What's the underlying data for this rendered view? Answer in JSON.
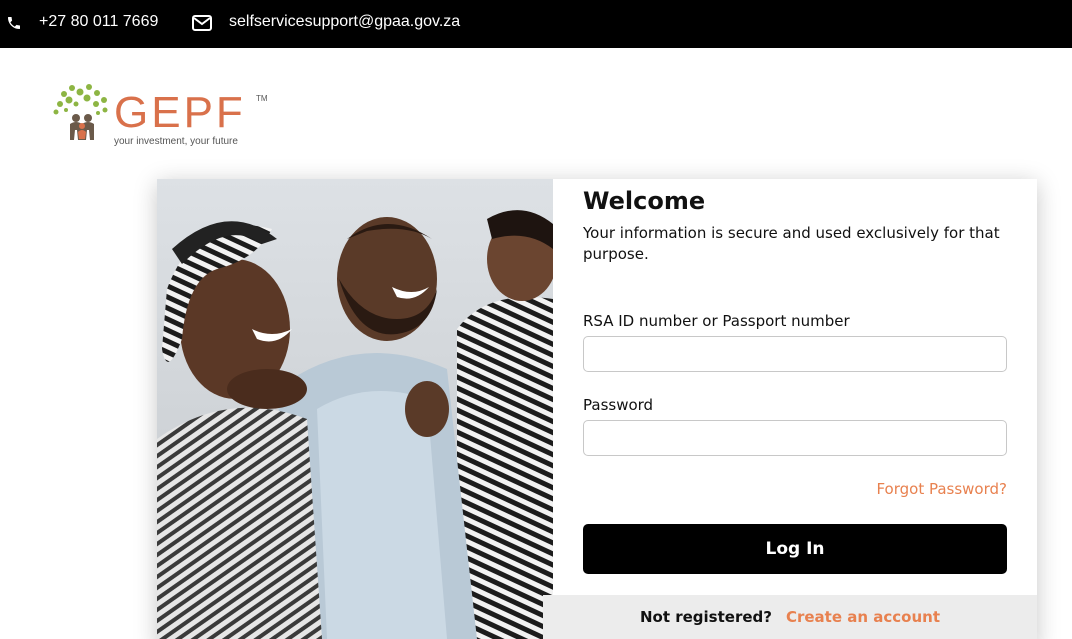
{
  "topbar": {
    "phone_icon": "phone-icon",
    "phone": "+27 80 011 7669",
    "mail_icon": "mail-icon",
    "email": "selfservicesupport@gpaa.gov.za"
  },
  "logo": {
    "word": "GEPF",
    "tm": "TM",
    "tagline": "your investment, your future",
    "color": "#d9714b"
  },
  "hero_image": {
    "description_icon": "family-photo"
  },
  "login_form": {
    "title": "Welcome",
    "subtitle": "Your information is secure and used exclusively for that purpose.",
    "id_label": "RSA ID number or Passport number",
    "id_value": "",
    "password_label": "Password",
    "password_value": "",
    "forgot_link": "Forgot Password?",
    "login_button": "Log In"
  },
  "register": {
    "question": "Not registered?",
    "link": "Create an account"
  },
  "colors": {
    "accent": "#e8814f",
    "topbar": "#000000",
    "button": "#000000"
  }
}
